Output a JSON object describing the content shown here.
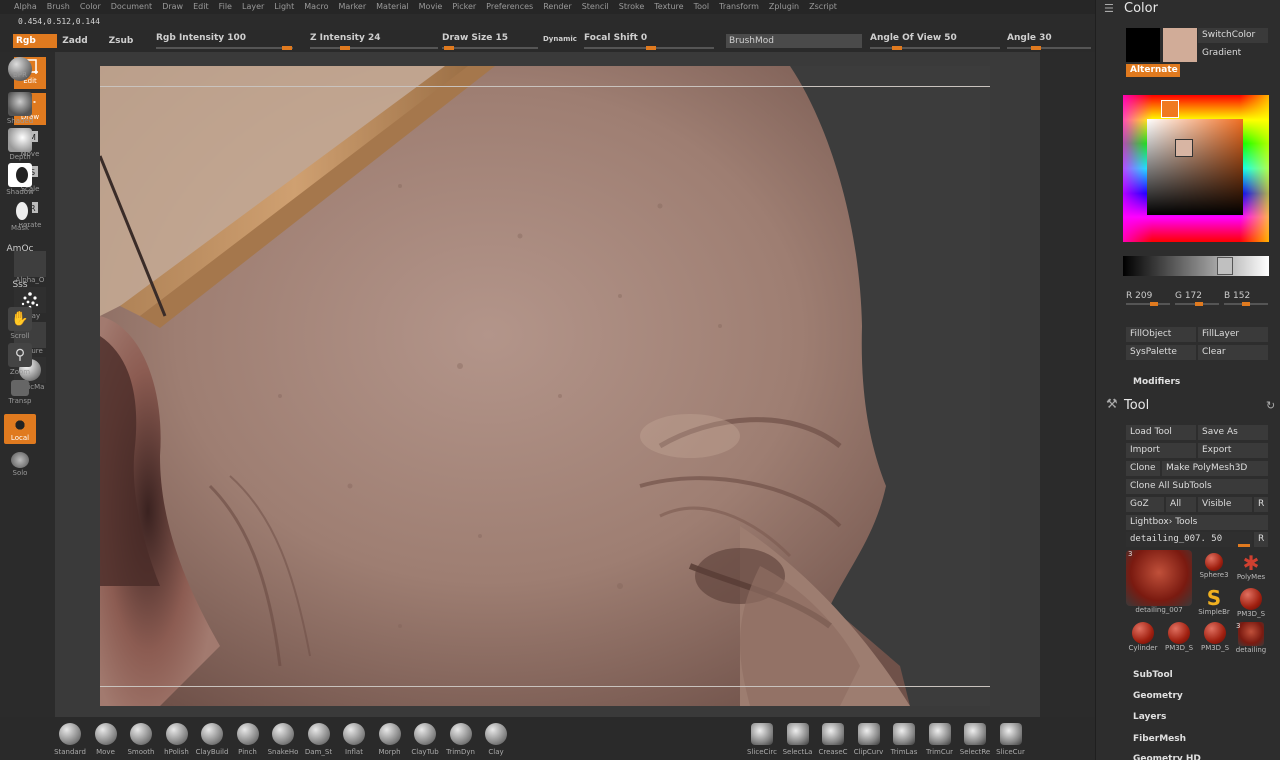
{
  "menubar": {
    "items": [
      "Alpha",
      "Brush",
      "Color",
      "Document",
      "Draw",
      "Edit",
      "File",
      "Layer",
      "Light",
      "Macro",
      "Marker",
      "Material",
      "Movie",
      "Picker",
      "Preferences",
      "Render",
      "Stencil",
      "Stroke",
      "Texture",
      "Tool",
      "Transform",
      "Zplugin",
      "Zscript"
    ]
  },
  "status": {
    "coords": "0.454,0.512,0.144"
  },
  "toolbar": {
    "rgb": "Rgb",
    "zadd": "Zadd",
    "zsub": "Zsub",
    "rgb_intensity": "Rgb Intensity 100",
    "rgb_intensity_value": 100,
    "z_intensity": "Z Intensity 24",
    "z_intensity_value": 24,
    "draw_size": "Draw Size 15",
    "draw_size_value": 15,
    "dynamic": "Dynamic",
    "focal_shift": "Focal Shift 0",
    "focal_shift_value": 0,
    "brushmod": "BrushMod",
    "angle_of_view": "Angle Of View 50",
    "angle_of_view_value": 50,
    "angle": "Angle 30",
    "angle_value": 30
  },
  "leftshelf": {
    "edit": "Edit",
    "draw": "Draw",
    "move": "Move",
    "scale": "Scale",
    "rotate": "Rotate",
    "alpha": "Alpha_O",
    "spray": "Spray",
    "texture": "Texture",
    "material": "BasicMa"
  },
  "rightshelf": {
    "bpr": "BPR",
    "shaded": "Shaded",
    "depth": "Depth",
    "shadow": "Shadow",
    "mask": "Mask",
    "amoc": "AmOc",
    "sss": "Sss",
    "scroll": "Scroll",
    "zoom": "Zoom",
    "transp": "Transp",
    "local": "Local",
    "solo": "Solo"
  },
  "colorpanel": {
    "title": "Color",
    "switchcolor": "SwitchColor",
    "gradient": "Gradient",
    "alternate": "Alternate",
    "main_color": "#d1ac98",
    "r": "R 209",
    "g": "G 172",
    "b": "B 152",
    "fillobject": "FillObject",
    "filllayer": "FillLayer",
    "syspalette": "SysPalette",
    "clear": "Clear",
    "modifiers": "Modifiers"
  },
  "toolpanel": {
    "title": "Tool",
    "load_tool": "Load Tool",
    "save_as": "Save As",
    "import": "Import",
    "export": "Export",
    "clone": "Clone",
    "make_polymesh": "Make PolyMesh3D",
    "clone_all": "Clone All SubTools",
    "goz": "GoZ",
    "all": "All",
    "visible": "Visible",
    "r": "R",
    "lightbox_tools": "Lightbox› Tools",
    "current_tool": "detailing_007. 50",
    "thumbs": [
      {
        "label": "detailing_007",
        "count": "3"
      },
      {
        "label": "Sphere3"
      },
      {
        "label": "PolyMes"
      },
      {
        "label": "SimpleBr"
      },
      {
        "label": "PM3D_S"
      },
      {
        "label": "Cylinder"
      },
      {
        "label": "PM3D_S"
      },
      {
        "label": "PM3D_S"
      },
      {
        "label": "detailing",
        "count": "3"
      }
    ],
    "subtool": "SubTool",
    "geometry": "Geometry",
    "layers": "Layers",
    "fibermesh": "FiberMesh",
    "cut_off": "Geometry HD"
  },
  "bottomshelf": {
    "brushes": [
      "Standard",
      "Move",
      "Smooth",
      "hPolish",
      "ClayBuild",
      "Pinch",
      "SnakeHo",
      "Dam_St",
      "Inflat",
      "Morph",
      "ClayTub",
      "TrimDyn",
      "Clay"
    ],
    "tools": [
      "SliceCirc",
      "SelectLa",
      "CreaseC",
      "ClipCurv",
      "TrimLas",
      "TrimCur",
      "SelectRe",
      "SliceCur"
    ]
  }
}
